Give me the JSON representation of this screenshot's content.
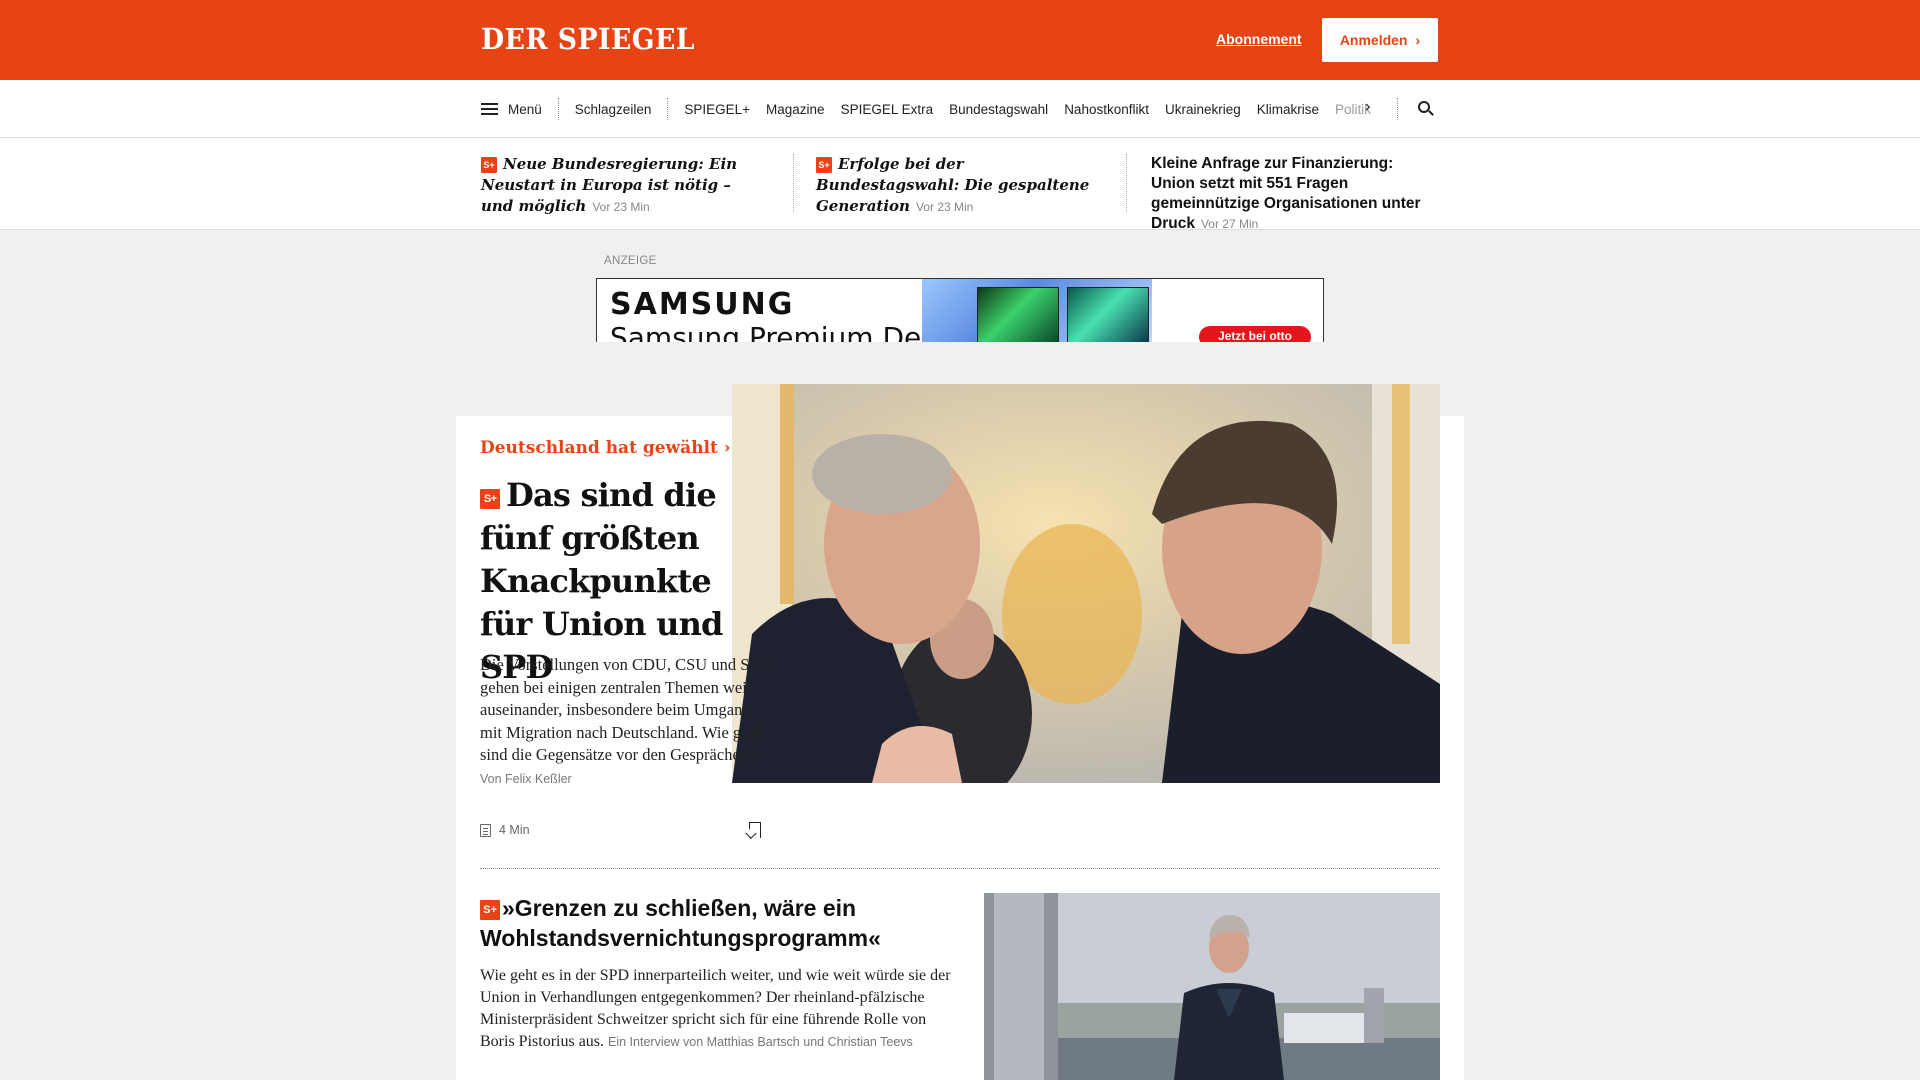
{
  "header": {
    "logo": "DER SPIEGEL",
    "subscription_link": "Abonnement",
    "login_button": "Anmelden",
    "brand_color": "#e64415"
  },
  "nav": {
    "menu_label": "Menü",
    "items": [
      "Schlagzeilen",
      "SPIEGEL+",
      "Magazine",
      "SPIEGEL Extra",
      "Bundestagswahl",
      "Nahostkonflikt",
      "Ukrainekrieg",
      "Klimakrise"
    ],
    "truncated_item": "Politik"
  },
  "top_teasers": [
    {
      "premium": true,
      "title": "Neue Bundesregierung: Ein Neustart in Europa ist nötig – und möglich",
      "time": "Vor 23 Min"
    },
    {
      "premium": true,
      "title": "Erfolge bei der Bundestagswahl: Die gespaltene Generation",
      "time": "Vor 23 Min"
    },
    {
      "premium": false,
      "title": "Kleine Anfrage zur Finanzierung: Union setzt mit 551 Fragen gemeinnützige Organisationen unter Druck",
      "time": "Vor 27 Min"
    }
  ],
  "premium_badge": "S+",
  "ad": {
    "label": "ANZEIGE",
    "brand": "SAMSUNG",
    "text": "Samsung Premium Deals",
    "cta": "Jetzt bei otto"
  },
  "lead_article": {
    "kicker": "Deutschland hat gewählt",
    "headline": "Das sind die fünf größten Knackpunkte für Union und SPD",
    "lead": "Die Vorstellungen von CDU, CSU und SPD gehen bei einigen zentralen Themen weit auseinander, insbesondere beim Umgang mit Migration nach Deutschland. Wie groß sind die Gegensätze vor den Gesprächen?",
    "author": "Von Felix Keßler",
    "read_time": "4 Min"
  },
  "second_article": {
    "headline": "»Grenzen zu schließen, wäre ein Wohlstandsvernichtungsprogramm«",
    "lead": "Wie geht es in der SPD innerparteilich weiter, und wie weit würde sie der Union in Verhandlungen entgegenkommen? Der rheinland-pfälzische Ministerpräsident Schweitzer spricht sich für eine führende Rolle von Boris Pistorius aus.",
    "author": "Ein Interview von Matthias Bartsch und Christian Teevs"
  }
}
